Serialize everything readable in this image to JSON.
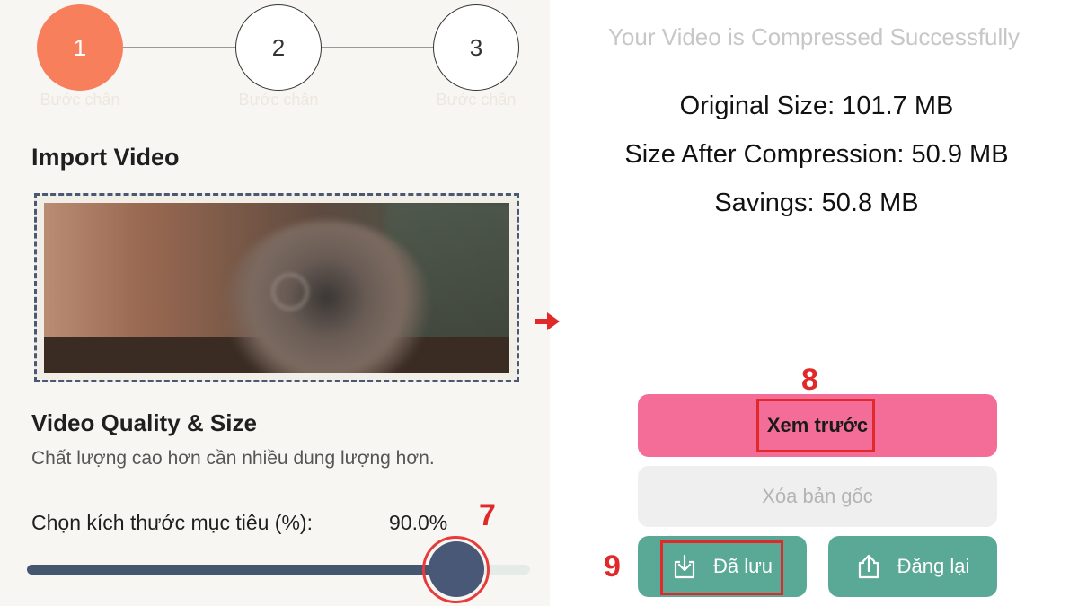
{
  "steps": [
    {
      "number": "1",
      "label": "Bước chân"
    },
    {
      "number": "2",
      "label": "Bước chân"
    },
    {
      "number": "3",
      "label": "Bước chân"
    }
  ],
  "import": {
    "title": "Import Video"
  },
  "quality": {
    "title": "Video Quality & Size",
    "description": "Chất lượng cao hơn cần nhiều dung lượng hơn.",
    "target_label": "Chọn kích thước mục tiêu (%):",
    "target_value": "90.0%",
    "slider_fraction": 0.9
  },
  "result": {
    "title": "Your Video is Compressed Successfully",
    "original": "Original Size: 101.7 MB",
    "after": "Size After Compression: 50.9 MB",
    "savings": "Savings: 50.8 MB"
  },
  "buttons": {
    "preview": "Xem trước",
    "delete_original": "Xóa bản gốc",
    "saved": "Đã lưu",
    "repost": "Đăng lại"
  },
  "annotations": {
    "slider": "7",
    "preview": "8",
    "saved": "9"
  },
  "colors": {
    "accent": "#f77f5c",
    "preview_button": "#f46d98",
    "action_button": "#5aa896",
    "slider": "#455670",
    "annotation": "#e02a2a"
  }
}
